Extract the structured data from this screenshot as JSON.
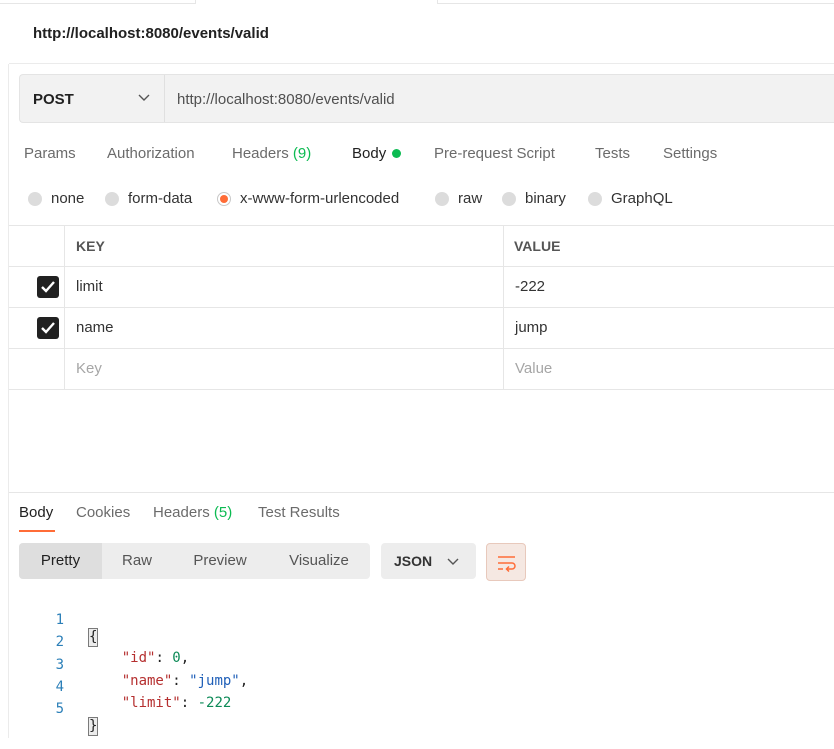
{
  "request_title": "http://localhost:8080/events/valid",
  "url_bar": {
    "method": "POST",
    "url": "http://localhost:8080/events/valid"
  },
  "request_tabs": {
    "params": "Params",
    "authorization": "Authorization",
    "headers": "Headers",
    "headers_count": "(9)",
    "body": "Body",
    "pre_request": "Pre-request Script",
    "tests": "Tests",
    "settings": "Settings"
  },
  "body_types": {
    "none": "none",
    "form_data": "form-data",
    "urlencoded": "x-www-form-urlencoded",
    "raw": "raw",
    "binary": "binary",
    "graphql": "GraphQL",
    "selected": "x-www-form-urlencoded"
  },
  "kv_table": {
    "key_header": "KEY",
    "value_header": "VALUE",
    "rows": [
      {
        "key": "limit",
        "value": "-222",
        "checked": true
      },
      {
        "key": "name",
        "value": "jump",
        "checked": true
      }
    ],
    "key_placeholder": "Key",
    "value_placeholder": "Value"
  },
  "response_tabs": {
    "body": "Body",
    "cookies": "Cookies",
    "headers": "Headers",
    "headers_count": "(5)",
    "test_results": "Test Results"
  },
  "view_modes": {
    "pretty": "Pretty",
    "raw": "Raw",
    "preview": "Preview",
    "visualize": "Visualize"
  },
  "format_select": "JSON",
  "code": {
    "line_numbers": [
      "1",
      "2",
      "3",
      "4",
      "5"
    ],
    "open_brace": "{",
    "close_brace": "}",
    "id_key": "\"id\"",
    "id_value": "0",
    "name_key": "\"name\"",
    "name_value": "\"jump\"",
    "limit_key": "\"limit\"",
    "limit_value": "-222"
  },
  "colors": {
    "accent": "#ff6c37",
    "green": "#0cbb52"
  }
}
